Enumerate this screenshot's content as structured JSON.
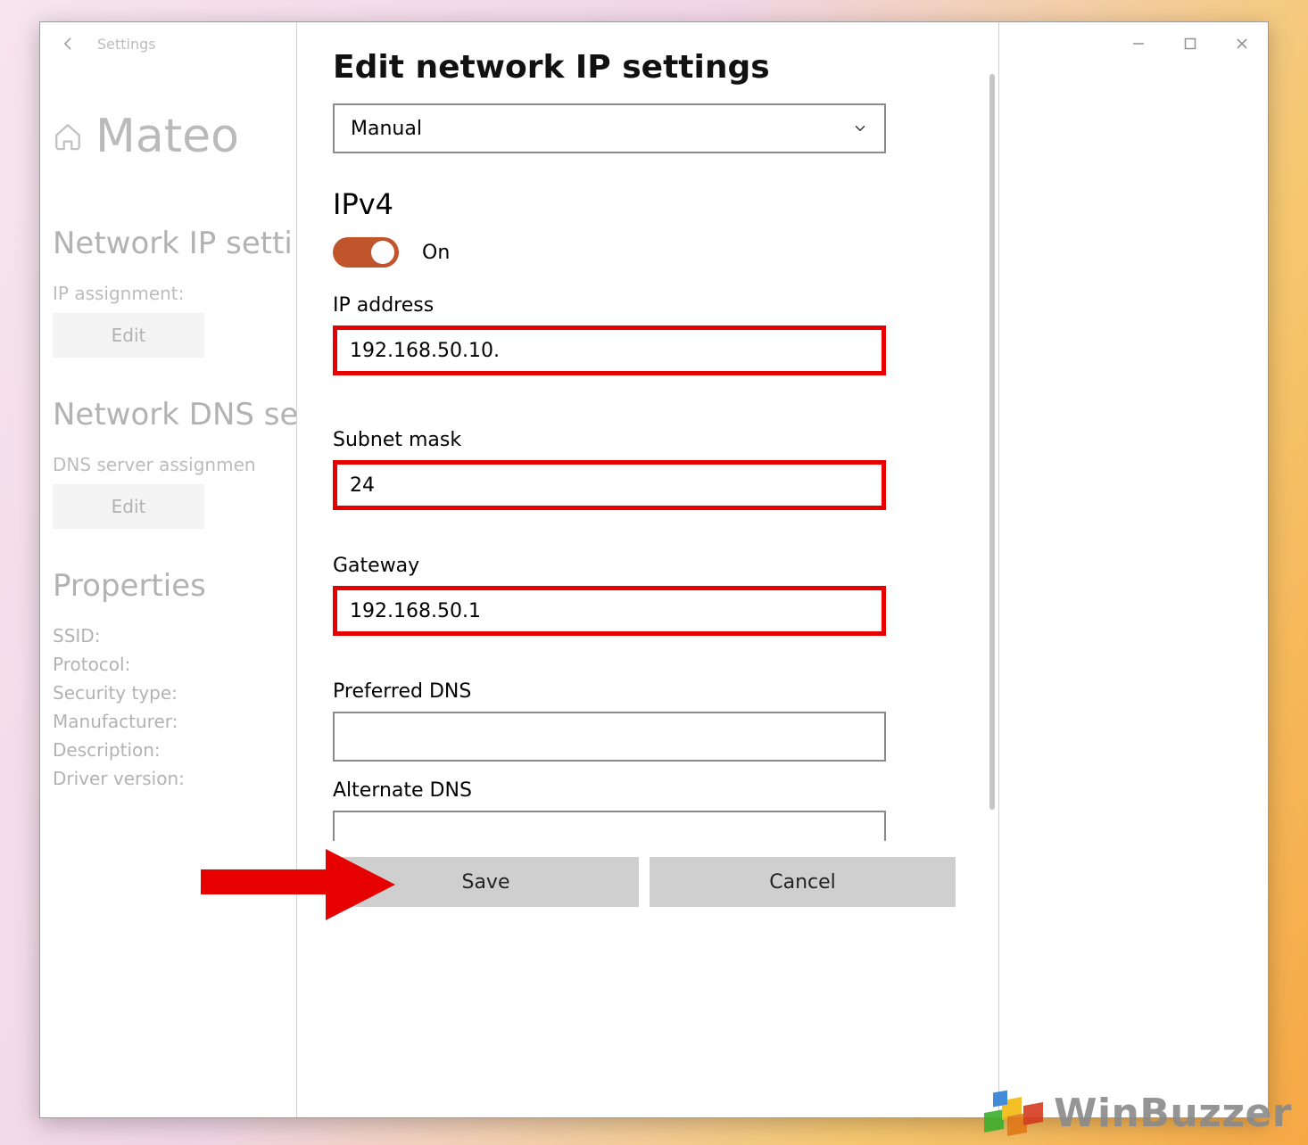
{
  "titlebar": {
    "title": "Settings"
  },
  "bg": {
    "user": "Mateo",
    "section1": "Network IP setti",
    "ip_assignment_label": "IP assignment:",
    "edit1": "Edit",
    "section2": "Network DNS se",
    "dns_assignment_label": "DNS server assignmen",
    "edit2": "Edit",
    "section3": "Properties",
    "props": [
      "SSID:",
      "Protocol:",
      "Security type:",
      "Manufacturer:",
      "Description:",
      "Driver version:"
    ]
  },
  "dialog": {
    "title": "Edit network IP settings",
    "mode": "Manual",
    "ipv4_label": "IPv4",
    "toggle_state": "On",
    "fields": {
      "ip_label": "IP address",
      "ip_value": "192.168.50.10.",
      "subnet_label": "Subnet mask",
      "subnet_value": "24",
      "gateway_label": "Gateway",
      "gateway_value": "192.168.50.1",
      "dns1_label": "Preferred DNS",
      "dns1_value": "",
      "dns2_label": "Alternate DNS",
      "dns2_value": ""
    },
    "save": "Save",
    "cancel": "Cancel"
  },
  "watermark": "WinBuzzer"
}
